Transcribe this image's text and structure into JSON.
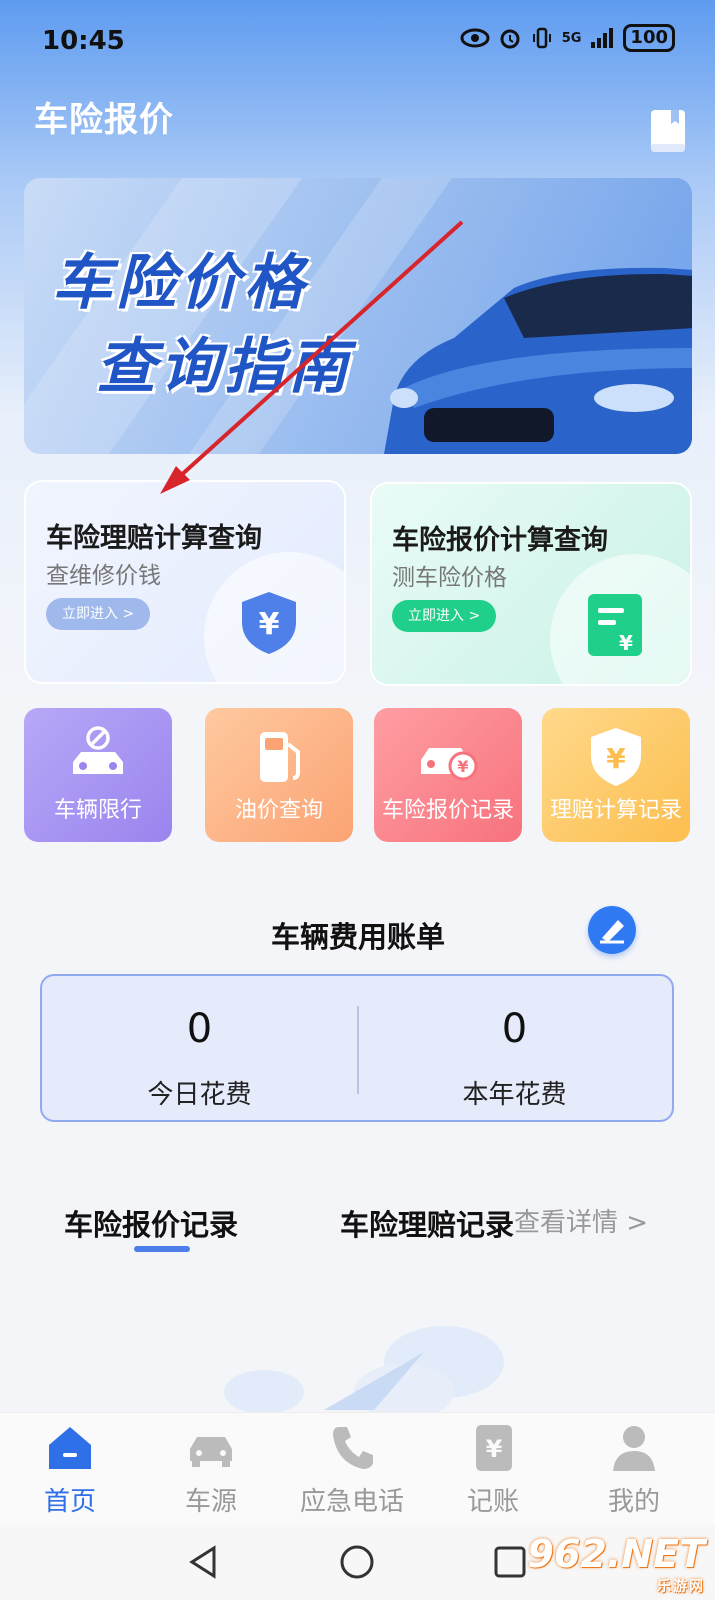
{
  "status_bar": {
    "time": "10:45",
    "network": "5G",
    "battery": "100"
  },
  "header": {
    "title": "车险报价"
  },
  "banner": {
    "line1": "车险价格",
    "line2": "查询指南"
  },
  "feature_cards": [
    {
      "title": "车险理赔计算查询",
      "subtitle": "查维修价钱",
      "button": "立即进入 >"
    },
    {
      "title": "车险报价计算查询",
      "subtitle": "测车险价格",
      "button": "立即进入 >"
    }
  ],
  "tiles": [
    {
      "label": "车辆限行",
      "icon": "car-restriction-icon"
    },
    {
      "label": "油价查询",
      "icon": "gas-pump-icon"
    },
    {
      "label": "车险报价记录",
      "icon": "car-yuan-icon"
    },
    {
      "label": "理赔计算记录",
      "icon": "shield-yuan-icon"
    }
  ],
  "bill": {
    "title": "车辆费用账单",
    "today_value": "0",
    "today_label": "今日花费",
    "year_value": "0",
    "year_label": "本年花费"
  },
  "records": {
    "tab1": "车险报价记录",
    "tab2": "车险理赔记录",
    "more": "查看详情 >"
  },
  "bottom_nav": [
    {
      "label": "首页",
      "icon": "home-icon",
      "active": true
    },
    {
      "label": "车源",
      "icon": "car-icon",
      "active": false
    },
    {
      "label": "应急电话",
      "icon": "phone-icon",
      "active": false
    },
    {
      "label": "记账",
      "icon": "ledger-icon",
      "active": false
    },
    {
      "label": "我的",
      "icon": "user-icon",
      "active": false
    }
  ],
  "watermark": {
    "main": "962.NET",
    "sub": "乐游网"
  },
  "colors": {
    "primary": "#2f6fe8",
    "green": "#1fcf8a",
    "annotation_arrow": "#d8252b"
  }
}
